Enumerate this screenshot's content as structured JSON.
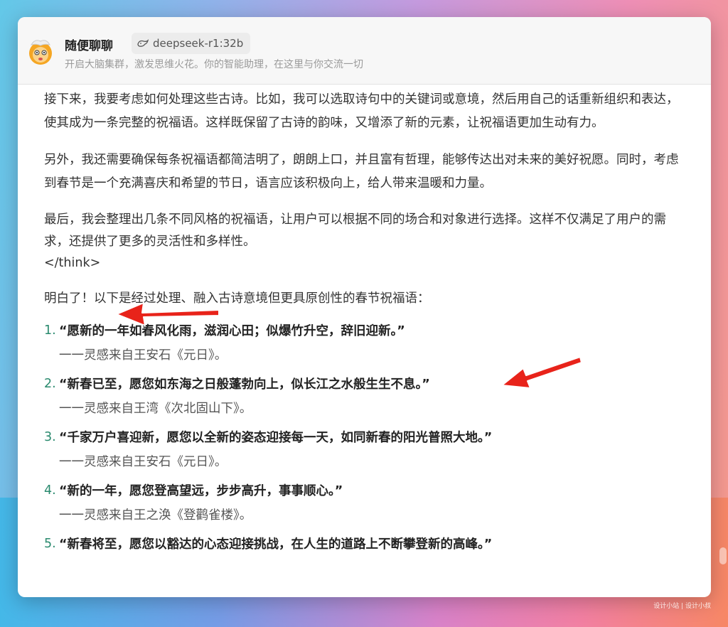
{
  "header": {
    "title": "随便聊聊",
    "model": "deepseek-r1:32b",
    "subtitle": "开启大脑集群，激发思维火花。你的智能助理，在这里与你交流一切"
  },
  "content": {
    "paragraphs": [
      "接下来，我要考虑如何处理这些古诗。比如，我可以选取诗句中的关键词或意境，然后用自己的话重新组织和表达，使其成为一条完整的祝福语。这样既保留了古诗的韵味，又增添了新的元素，让祝福语更加生动有力。",
      "另外，我还需要确保每条祝福语都简洁明了，朗朗上口，并且富有哲理，能够传达出对未来的美好祝愿。同时，考虑到春节是一个充满喜庆和希望的节日，语言应该积极向上，给人带来温暖和力量。",
      "最后，我会整理出几条不同风格的祝福语，让用户可以根据不同的场合和对象进行选择。这样不仅满足了用户的需求，还提供了更多的灵活性和多样性。"
    ],
    "think_close": "</think>",
    "intro": "明白了！以下是经过处理、融入古诗意境但更具原创性的春节祝福语：",
    "items": [
      {
        "num": "1.",
        "quote": "“愿新的一年如春风化雨，滋润心田；似爆竹升空，辞旧迎新。”",
        "source": "一一灵感来自王安石《元日》。"
      },
      {
        "num": "2.",
        "quote": "“新春已至，愿您如东海之日般蓬勃向上，似长江之水般生生不息。”",
        "source": "一一灵感来自王湾《次北固山下》。"
      },
      {
        "num": "3.",
        "quote": "“千家万户喜迎新，愿您以全新的姿态迎接每一天，如同新春的阳光普照大地。”",
        "source": "一一灵感来自王安石《元日》。"
      },
      {
        "num": "4.",
        "quote": "“新的一年，愿您登高望远，步步高升，事事顺心。”",
        "source": "一一灵感来自王之涣《登鹳雀楼》。"
      },
      {
        "num": "5.",
        "quote": "“新春将至，愿您以豁达的心态迎接挑战，在人生的道路上不断攀登新的高峰。”",
        "source": ""
      }
    ]
  },
  "watermark": "设计小站  |  设计小叔",
  "colors": {
    "accent_number": "#2a8a6e",
    "arrow": "#e8231a"
  }
}
